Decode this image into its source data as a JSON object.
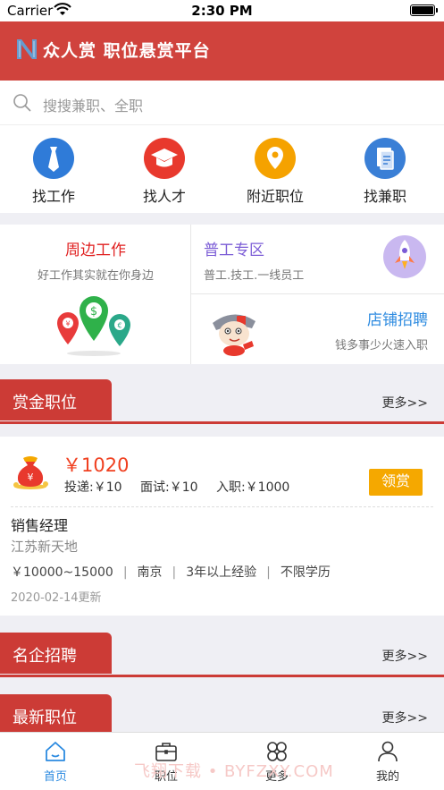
{
  "status_bar": {
    "carrier": "Carrier",
    "time": "2:30 PM"
  },
  "header": {
    "title": "众人赏 职位悬赏平台"
  },
  "search": {
    "placeholder": "搜搜兼职、全职"
  },
  "quick_nav": [
    {
      "label": "找工作",
      "icon": "tie-icon",
      "color": "#2f7bd8"
    },
    {
      "label": "找人才",
      "icon": "graduation-cap-icon",
      "color": "#e8392d"
    },
    {
      "label": "附近职位",
      "icon": "location-pin-icon",
      "color": "#f5a200"
    },
    {
      "label": "找兼职",
      "icon": "document-icon",
      "color": "#3a7fd6"
    }
  ],
  "features": {
    "nearby": {
      "title": "周边工作",
      "subtitle": "好工作其实就在你身边"
    },
    "general": {
      "title": "普工专区",
      "subtitle": "普工.技工.一线员工"
    },
    "shop": {
      "title": "店铺招聘",
      "subtitle": "钱多事少火速入职"
    }
  },
  "sections": {
    "bounty": {
      "title": "赏金职位",
      "more": "更多>>"
    },
    "famous": {
      "title": "名企招聘",
      "more": "更多>>"
    },
    "latest": {
      "title": "最新职位",
      "more": "更多>>"
    }
  },
  "bounty_job": {
    "amount": "￥1020",
    "stages": [
      "投递:￥10",
      "面试:￥10",
      "入职:￥1000"
    ],
    "claim_label": "领赏",
    "title": "销售经理",
    "company": "江苏新天地",
    "salary": "￥10000~15000",
    "city": "南京",
    "experience": "3年以上经验",
    "education": "不限学历",
    "separator": "|",
    "updated": "2020-02-14更新"
  },
  "tab_bar": [
    {
      "label": "首页",
      "icon": "home-icon",
      "active": true
    },
    {
      "label": "职位",
      "icon": "briefcase-icon",
      "active": false
    },
    {
      "label": "更多",
      "icon": "grid-icon",
      "active": false
    },
    {
      "label": "我的",
      "icon": "person-icon",
      "active": false
    }
  ],
  "watermark": "飞翔下载 • BYFZXY.COM",
  "colors": {
    "brand": "#d0433d",
    "accent_orange": "#f5a800",
    "active_tab": "#2b8ae0"
  }
}
